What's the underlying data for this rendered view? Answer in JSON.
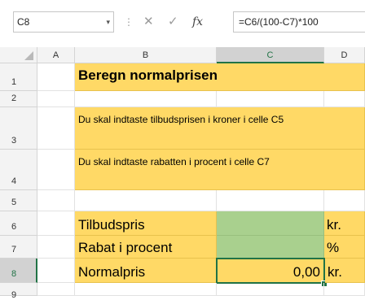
{
  "formula_bar": {
    "name_box": "C8",
    "name_box_dropdown_icon": "chevron-down-icon",
    "cancel_glyph": "✕",
    "enter_glyph": "✓",
    "fx_glyph": "fx",
    "formula": "=C6/(100-C7)*100"
  },
  "columns": [
    "A",
    "B",
    "C",
    "D"
  ],
  "selected_column": "C",
  "rows": [
    "1",
    "2",
    "3",
    "4",
    "5",
    "6",
    "7",
    "8",
    "9"
  ],
  "selected_row": "8",
  "cells": {
    "B1": "Beregn normalprisen",
    "B3": "Du skal indtaste tilbudsprisen i kroner i celle C5",
    "B4": "Du skal indtaste rabatten i procent i celle C7",
    "B6": "Tilbudspris",
    "D6": "kr.",
    "B7": "Rabat i procent",
    "D7": "%",
    "B8": "Normalpris",
    "C8": "0,00",
    "D8": "kr."
  },
  "colors": {
    "yellow_fill": "#FFD966",
    "green_fill": "#A9D08E",
    "excel_green": "#217346"
  }
}
